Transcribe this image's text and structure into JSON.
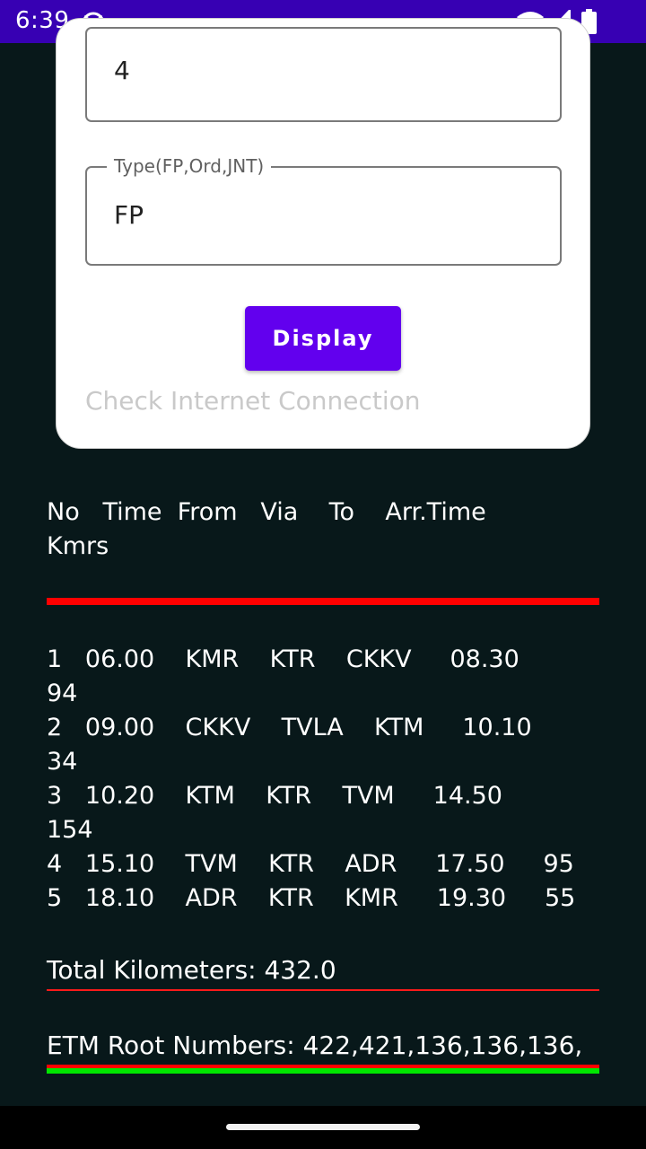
{
  "status_bar": {
    "time": "6:39",
    "icons": [
      "cat-notification-icon",
      "wifi-icon",
      "cell-signal-icon",
      "battery-icon"
    ]
  },
  "form": {
    "field_1_value": "4",
    "field_2_label": "Type(FP,Ord,JNT)",
    "field_2_value": "FP",
    "display_button": "Display",
    "message": "Check Internet Connection"
  },
  "schedule": {
    "header_line_1": "No   Time  From   Via    To    Arr.Time",
    "header_line_2": "Kmrs",
    "rows": [
      "1   06.00    KMR    KTR    CKKV     08.30",
      "94",
      "2   09.00    CKKV    TVLA    KTM     10.10",
      "34",
      "3   10.20    KTM    KTR    TVM     14.50",
      "154",
      "4   15.10    TVM    KTR    ADR     17.50     95",
      "5   18.10    ADR    KTR    KMR     19.30     55"
    ]
  },
  "summary": {
    "total_km": "Total Kilometers: 432.0",
    "etm_roots": "ETM Root Numbers: 422,421,136,136,136,"
  },
  "colors": {
    "status_bar": "#3700b3",
    "background": "#08181a",
    "button": "#6200ee",
    "rule_red": "#ff0000",
    "rule_green": "#00e600"
  }
}
